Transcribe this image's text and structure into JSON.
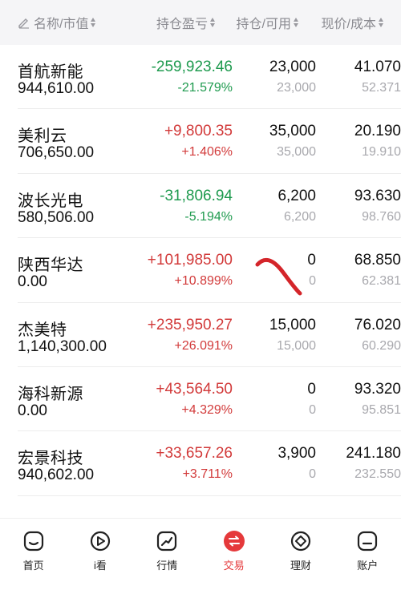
{
  "header": {
    "name_col": "名称/市值",
    "pl_col": "持仓盈亏",
    "pos_col": "持仓/可用",
    "price_col": "现价/成本"
  },
  "rows": [
    {
      "name": "首航新能",
      "market_value": "944,610.00",
      "pl": "-259,923.46",
      "pl_pct": "-21.579%",
      "qty": "23,000",
      "avail": "23,000",
      "price": "41.070",
      "cost": "52.371",
      "trend": "down"
    },
    {
      "name": "美利云",
      "market_value": "706,650.00",
      "pl": "+9,800.35",
      "pl_pct": "+1.406%",
      "qty": "35,000",
      "avail": "35,000",
      "price": "20.190",
      "cost": "19.910",
      "trend": "up"
    },
    {
      "name": "波长光电",
      "market_value": "580,506.00",
      "pl": "-31,806.94",
      "pl_pct": "-5.194%",
      "qty": "6,200",
      "avail": "6,200",
      "price": "93.630",
      "cost": "98.760",
      "trend": "down"
    },
    {
      "name": "陕西华达",
      "market_value": "0.00",
      "pl": "+101,985.00",
      "pl_pct": "+10.899%",
      "qty": "0",
      "avail": "0",
      "price": "68.850",
      "cost": "62.381",
      "trend": "up"
    },
    {
      "name": "杰美特",
      "market_value": "1,140,300.00",
      "pl": "+235,950.27",
      "pl_pct": "+26.091%",
      "qty": "15,000",
      "avail": "15,000",
      "price": "76.020",
      "cost": "60.290",
      "trend": "up"
    },
    {
      "name": "海科新源",
      "market_value": "0.00",
      "pl": "+43,564.50",
      "pl_pct": "+4.329%",
      "qty": "0",
      "avail": "0",
      "price": "93.320",
      "cost": "95.851",
      "trend": "up"
    },
    {
      "name": "宏景科技",
      "market_value": "940,602.00",
      "pl": "+33,657.26",
      "pl_pct": "+3.711%",
      "qty": "3,900",
      "avail": "0",
      "price": "241.180",
      "cost": "232.550",
      "trend": "up"
    }
  ],
  "tabs": [
    {
      "label": "首页",
      "icon": "home-icon"
    },
    {
      "label": "i看",
      "icon": "watch-icon"
    },
    {
      "label": "行情",
      "icon": "market-chart-icon"
    },
    {
      "label": "交易",
      "icon": "trade-icon"
    },
    {
      "label": "理财",
      "icon": "wealth-icon"
    },
    {
      "label": "账户",
      "icon": "account-icon"
    }
  ],
  "colors": {
    "up": "#d23a3a",
    "down": "#1e9a4e",
    "accent": "#e5393b",
    "annotation_stroke": "#d4252a"
  }
}
